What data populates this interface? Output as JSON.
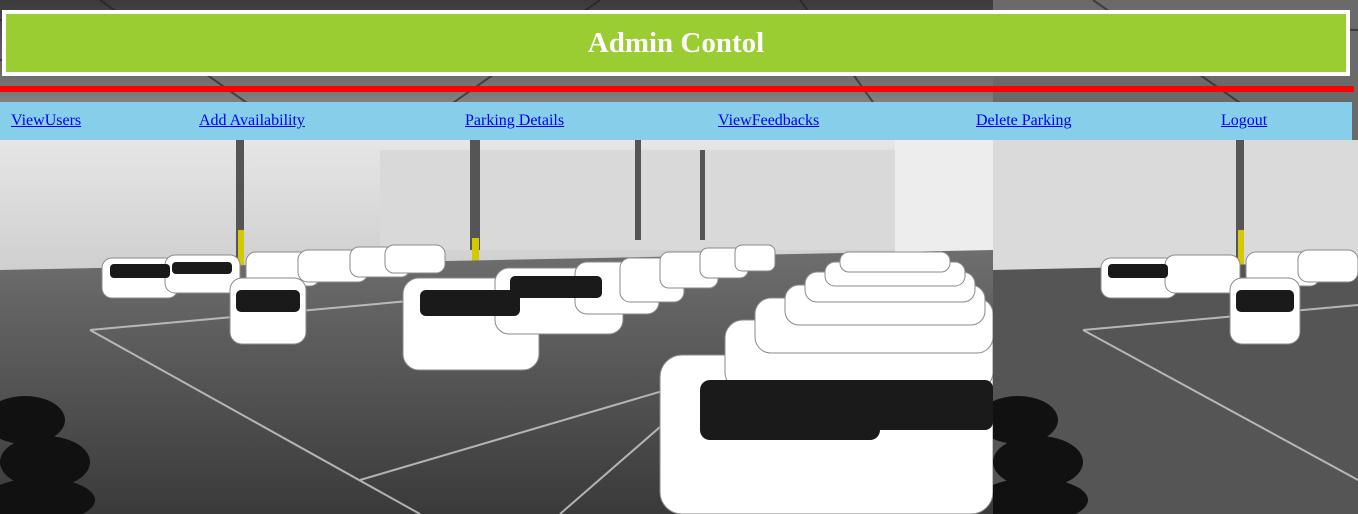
{
  "header": {
    "title": "Admin Contol"
  },
  "nav": {
    "items": [
      {
        "label": "ViewUsers"
      },
      {
        "label": "Add Availability"
      },
      {
        "label": "Parking Details"
      },
      {
        "label": "ViewFeedbacks"
      },
      {
        "label": "Delete Parking"
      },
      {
        "label": "Logout"
      }
    ]
  },
  "colors": {
    "header_bg": "#9acd32",
    "header_text": "#ffffff",
    "rule": "#ff0000",
    "nav_bg": "#87ceeb",
    "link": "#0000ee"
  },
  "background": {
    "icon": "garage-photo"
  }
}
